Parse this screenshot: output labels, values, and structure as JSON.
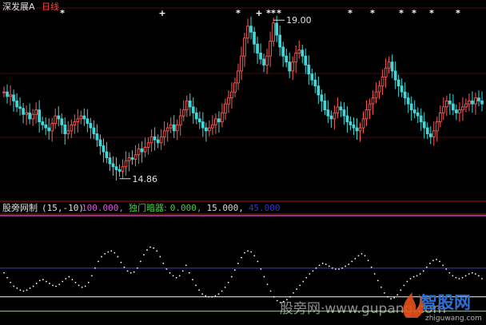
{
  "header": {
    "stock_name": "深发展A",
    "period": "日线"
  },
  "chart_data": [
    {
      "type": "candlestick",
      "title": "深发展A",
      "period_label": "日线",
      "ylim": [
        14.0,
        20.3
      ],
      "high_marker": {
        "label": "19.00",
        "value": 20.0
      },
      "low_marker": {
        "label": "14.86",
        "value": 14.86
      },
      "signal_markers": [
        "*",
        "+",
        "*",
        "+",
        "*",
        "*",
        "*",
        "*",
        "*",
        "*",
        "*",
        "*",
        "*"
      ],
      "close": [
        17.6,
        17.45,
        17.5,
        17.3,
        17.1,
        17.05,
        16.85,
        16.9,
        16.7,
        16.85,
        17.0,
        16.6,
        16.5,
        16.4,
        16.3,
        16.55,
        16.8,
        16.7,
        16.5,
        16.2,
        16.3,
        16.5,
        16.6,
        16.7,
        16.8,
        16.7,
        16.55,
        16.4,
        16.2,
        16.0,
        15.8,
        15.6,
        15.4,
        15.2,
        15.1,
        15.0,
        14.95,
        15.1,
        15.3,
        15.4,
        15.35,
        15.5,
        15.7,
        15.6,
        15.75,
        15.9,
        16.1,
        16.0,
        15.9,
        16.1,
        16.3,
        16.4,
        16.5,
        16.3,
        16.5,
        16.8,
        17.0,
        17.3,
        17.1,
        16.9,
        16.7,
        16.6,
        16.4,
        16.3,
        16.4,
        16.5,
        16.7,
        16.6,
        16.9,
        17.2,
        17.4,
        17.6,
        17.9,
        18.3,
        18.8,
        19.4,
        19.8,
        19.6,
        19.2,
        18.9,
        18.7,
        18.5,
        18.8,
        19.3,
        19.9,
        19.5,
        19.1,
        18.8,
        18.6,
        18.3,
        18.6,
        18.9,
        19.0,
        18.8,
        18.5,
        18.2,
        18.0,
        17.8,
        17.5,
        17.3,
        17.0,
        16.8,
        16.7,
        16.9,
        17.1,
        17.0,
        16.8,
        16.6,
        16.5,
        16.4,
        16.3,
        16.4,
        16.7,
        17.0,
        17.2,
        17.4,
        17.6,
        17.8,
        18.1,
        18.4,
        18.6,
        18.3,
        18.0,
        17.8,
        17.6,
        17.4,
        17.2,
        17.0,
        16.9,
        16.8,
        16.6,
        16.4,
        16.2,
        16.1,
        16.3,
        16.6,
        16.9,
        17.1,
        17.3,
        17.2,
        17.0,
        16.9,
        17.0,
        17.1,
        17.2,
        17.3,
        17.2,
        17.4,
        17.3,
        17.2
      ]
    },
    {
      "type": "line",
      "title": "股旁网制",
      "params": "(15,-10)",
      "ylim": [
        -12,
        100
      ],
      "legend_items": [
        {
          "name": "",
          "value_text": "100.000,",
          "color": "#dd55dd"
        },
        {
          "name": "独门暗器:",
          "value_text": "0.000,",
          "color": "#44cc44"
        },
        {
          "name": "",
          "value_text": "15.000,",
          "color": "#d8d8d8"
        },
        {
          "name": "",
          "value_text": "45.000",
          "color": "#3333cc"
        }
      ],
      "reference_lines": [
        {
          "value": 100,
          "color": "#dd55dd"
        },
        {
          "value": 45,
          "color": "#3333cc"
        },
        {
          "value": 15,
          "color": "#d8d8d8"
        },
        {
          "value": 0,
          "color": "#44cc44"
        }
      ],
      "series": [
        {
          "values": [
            40,
            35,
            30,
            26,
            24,
            22,
            21,
            22,
            24,
            26,
            29,
            32,
            33,
            31,
            29,
            27,
            26,
            28,
            31,
            34,
            36,
            33,
            30,
            27,
            25,
            26,
            30,
            37,
            45,
            52,
            57,
            60,
            62,
            63,
            61,
            57,
            51,
            46,
            42,
            40,
            41,
            45,
            52,
            59,
            64,
            67,
            66,
            63,
            57,
            50,
            44,
            40,
            37,
            35,
            37,
            42,
            48,
            40,
            33,
            27,
            22,
            18,
            16,
            15,
            15,
            16,
            18,
            21,
            25,
            30,
            36,
            43,
            50,
            56,
            61,
            63,
            62,
            58,
            52,
            44,
            36,
            28,
            21,
            15,
            11,
            9,
            10,
            12,
            15,
            19,
            23,
            27,
            31,
            35,
            39,
            42,
            45,
            48,
            50,
            49,
            47,
            45,
            44,
            44,
            45,
            47,
            49,
            52,
            55,
            58,
            60,
            58,
            53,
            46,
            39,
            32,
            25,
            19,
            15,
            13,
            14,
            17,
            22,
            27,
            31,
            34,
            36,
            37,
            39,
            42,
            46,
            50,
            53,
            54,
            52,
            48,
            44,
            40,
            37,
            35,
            34,
            35,
            37,
            39,
            40,
            39,
            37,
            34
          ]
        }
      ]
    }
  ],
  "watermark": {
    "site_text": "股旁网·www.gupang.com",
    "logo_text": "智股网",
    "logo_url_text": "zhiguwang.com"
  }
}
